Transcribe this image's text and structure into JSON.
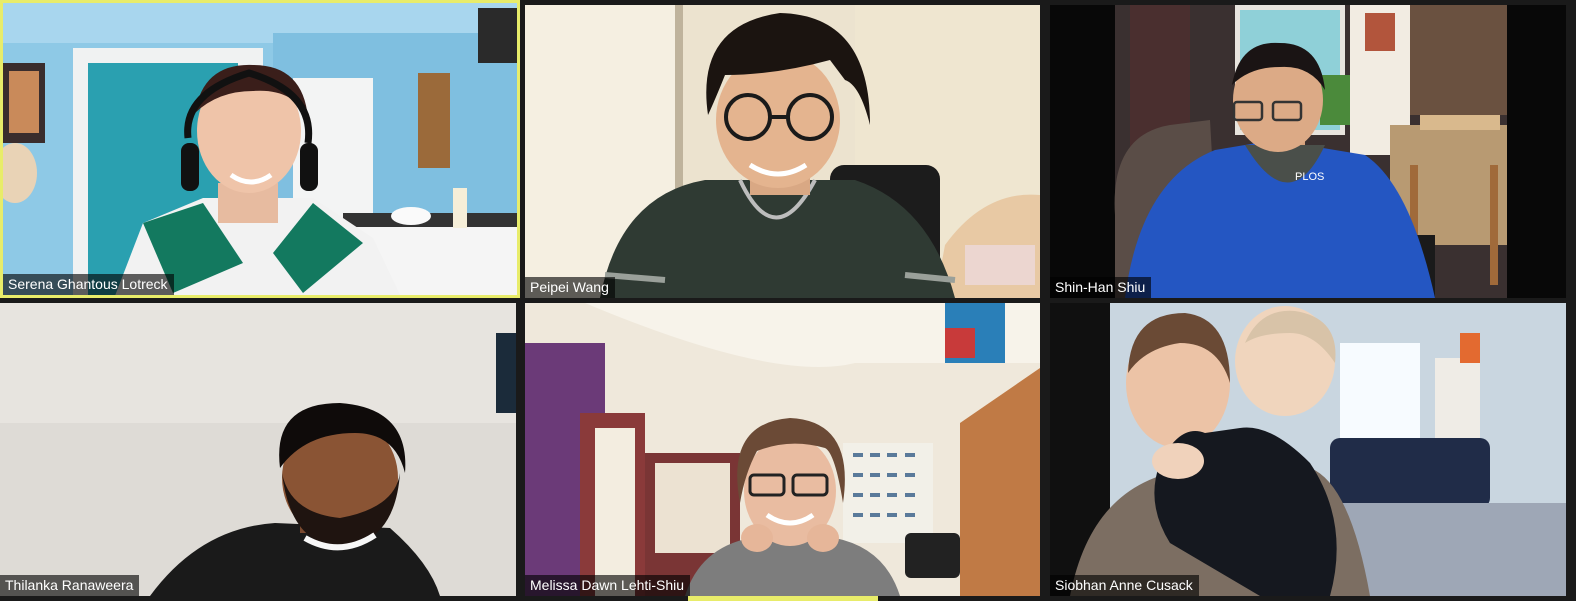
{
  "meeting": {
    "participants": [
      {
        "name": "Serena Ghantous Lotreck",
        "active_speaker": true
      },
      {
        "name": "Peipei Wang",
        "active_speaker": false
      },
      {
        "name": "Shin-Han Shiu",
        "active_speaker": false
      },
      {
        "name": "Thilanka Ranaweera",
        "active_speaker": false
      },
      {
        "name": "Melissa Dawn Lehti-Shiu",
        "active_speaker": false
      },
      {
        "name": "Siobhan Anne Cusack",
        "active_speaker": false
      }
    ],
    "colors": {
      "background": "#1a1a1a",
      "active_speaker_border": "#e8ec6a",
      "name_tag_bg": "rgba(0,0,0,0.62)"
    }
  }
}
